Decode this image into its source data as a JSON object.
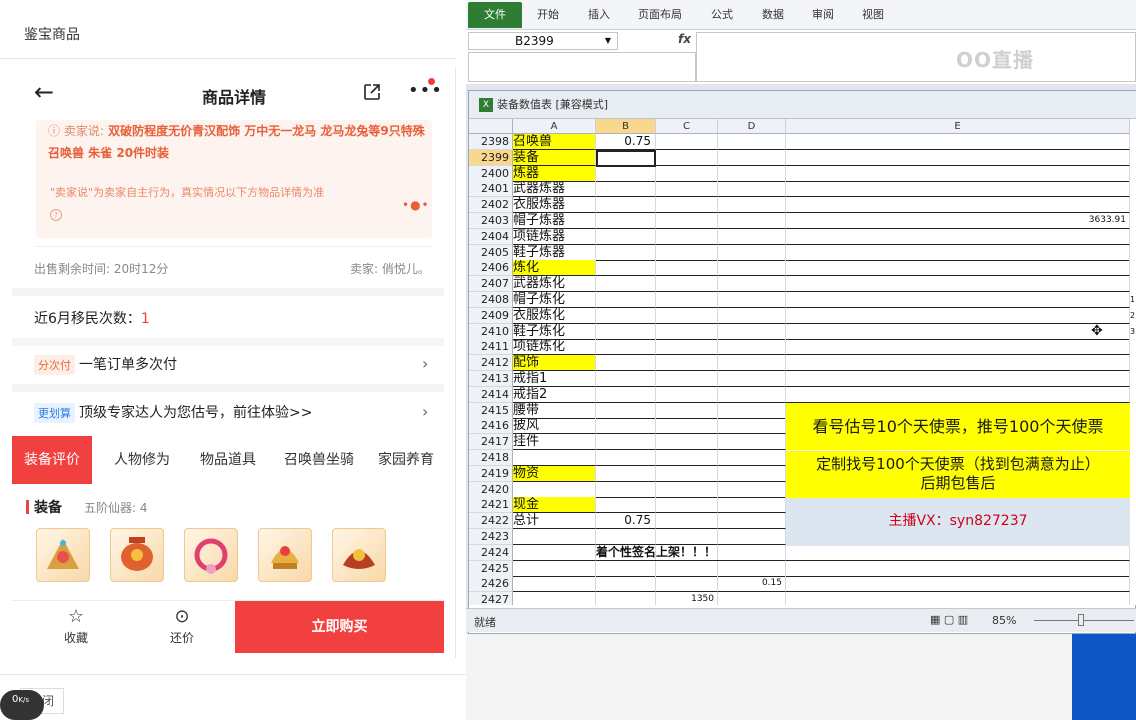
{
  "app": {
    "top_title": "鉴宝商品"
  },
  "nav": {
    "title": "商品详情",
    "back_icon": "←"
  },
  "seller": {
    "prefix": "卖家说:",
    "text": "双破防程度无价青汉配饰 万中无一龙马 龙马龙兔等9只特殊召唤兽 朱雀 20件时装",
    "note": "\"卖家说\"为卖家自主行为，真实情况以下方物品详情为准"
  },
  "meta": {
    "time_left": "出售剩余时间: 20时12分",
    "seller_name": "卖家: 俏悦儿。"
  },
  "migration": {
    "label": "近6月移民次数：",
    "count": "1"
  },
  "installment": {
    "tag": "分次付",
    "text": "一笔订单多次付"
  },
  "appraise": {
    "tag": "更划算",
    "text": "顶级专家达人为您估号，前往体验>>"
  },
  "tabs": [
    {
      "label": "装备评价"
    },
    {
      "label": "人物修为"
    },
    {
      "label": "物品道具"
    },
    {
      "label": "召唤兽坐骑"
    },
    {
      "label": "家园养育"
    }
  ],
  "equipment": {
    "title": "装备",
    "sub": "五阶仙器: 4"
  },
  "bottom": {
    "fav": "收藏",
    "bargain": "还价",
    "buy": "立即购买"
  },
  "footer": {
    "close": "关闭",
    "speed": "0",
    "speed_unit": "K/s"
  },
  "excel": {
    "ribbon_tabs": [
      "文件",
      "开始",
      "插入",
      "页面布局",
      "公式",
      "数据",
      "审阅",
      "视图"
    ],
    "name_box": "B2399",
    "fx": "fx",
    "watermark": "OO直播",
    "workbook_title": "装备数值表  [兼容模式]",
    "columns": [
      "A",
      "B",
      "C",
      "D",
      "E"
    ],
    "rows": [
      {
        "n": "2398",
        "a": "召唤兽",
        "yel": true,
        "b": "0.75"
      },
      {
        "n": "2399",
        "a": "装备",
        "yel": true
      },
      {
        "n": "2400",
        "a": "炼器",
        "yel": true
      },
      {
        "n": "2401",
        "a": "武器炼器"
      },
      {
        "n": "2402",
        "a": "衣服炼器"
      },
      {
        "n": "2403",
        "a": "帽子炼器",
        "e": "3633.91"
      },
      {
        "n": "2404",
        "a": "项链炼器"
      },
      {
        "n": "2405",
        "a": "鞋子炼器"
      },
      {
        "n": "2406",
        "a": "炼化",
        "yel": true
      },
      {
        "n": "2407",
        "a": "武器炼化"
      },
      {
        "n": "2408",
        "a": "帽子炼化"
      },
      {
        "n": "2409",
        "a": "衣服炼化"
      },
      {
        "n": "2410",
        "a": "鞋子炼化"
      },
      {
        "n": "2411",
        "a": "项链炼化"
      },
      {
        "n": "2412",
        "a": "配饰",
        "yel": true
      },
      {
        "n": "2413",
        "a": "戒指1"
      },
      {
        "n": "2414",
        "a": "戒指2"
      },
      {
        "n": "2415",
        "a": "腰带"
      },
      {
        "n": "2416",
        "a": "披风"
      },
      {
        "n": "2417",
        "a": "挂件"
      },
      {
        "n": "2418",
        "a": ""
      },
      {
        "n": "2419",
        "a": "物资",
        "yel": true
      },
      {
        "n": "2420",
        "a": ""
      },
      {
        "n": "2421",
        "a": "现金",
        "yel": true
      },
      {
        "n": "2422",
        "a": "总计",
        "b": "0.75"
      },
      {
        "n": "2423",
        "a": ""
      },
      {
        "n": "2424",
        "a": "",
        "banner": "着个性签名上架！！！"
      },
      {
        "n": "2425",
        "a": ""
      },
      {
        "n": "2426",
        "a": "",
        "d": "0.15"
      },
      {
        "n": "2427",
        "a": "",
        "c": "1350"
      }
    ],
    "edge_digits": [
      "1",
      "2",
      "3"
    ],
    "notice1": "看号估号10个天使票，推号100个天使票",
    "notice2_l1": "定制找号100个天使票（找到包满意为止）",
    "notice2_l2": "后期包售后",
    "notice3": "主播VX：syn827237",
    "status_ready": "就绪",
    "zoom": "85%"
  }
}
